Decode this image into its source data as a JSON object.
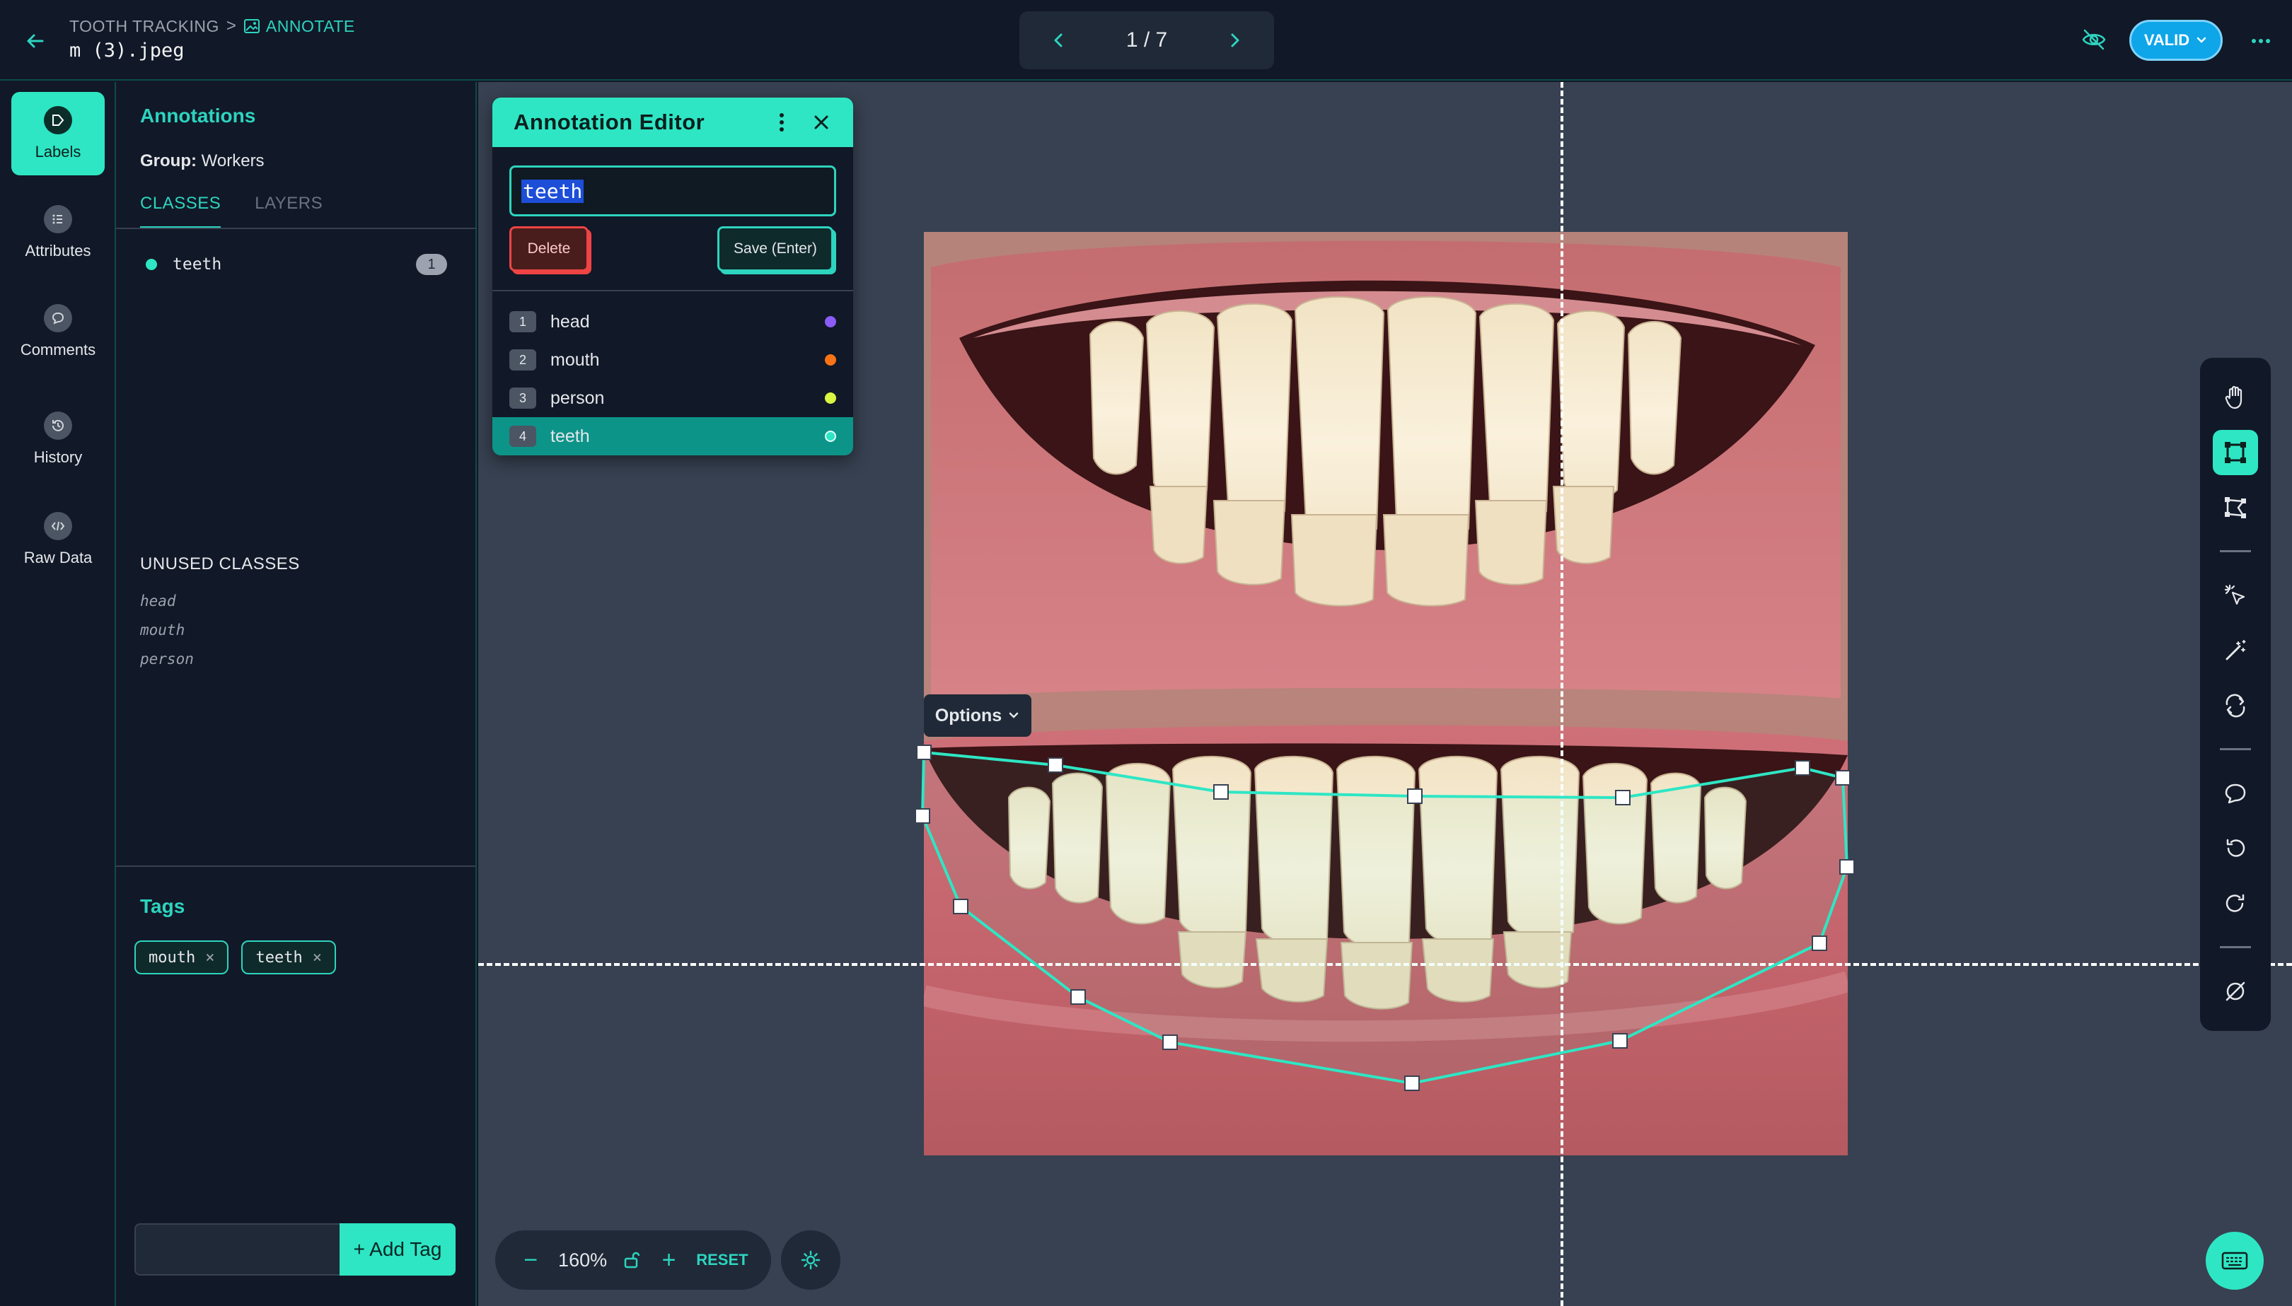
{
  "header": {
    "project": "TOOTH TRACKING",
    "separator": ">",
    "stage": "ANNOTATE",
    "filename": "m (3).jpeg",
    "pager": "1 / 7",
    "status": "VALID"
  },
  "rail": {
    "items": [
      {
        "label": "Labels",
        "icon": "tag-icon"
      },
      {
        "label": "Attributes",
        "icon": "list-icon"
      },
      {
        "label": "Comments",
        "icon": "comment-icon"
      },
      {
        "label": "History",
        "icon": "history-icon"
      },
      {
        "label": "Raw Data",
        "icon": "code-icon"
      }
    ]
  },
  "panel": {
    "title": "Annotations",
    "group_label": "Group:",
    "group_value": "Workers",
    "tabs": [
      "CLASSES",
      "LAYERS"
    ],
    "classes": [
      {
        "name": "teeth",
        "count": "1",
        "color": "#2ee6c4"
      }
    ],
    "unused_title": "UNUSED CLASSES",
    "unused": [
      "head",
      "mouth",
      "person"
    ],
    "tags_title": "Tags",
    "tags": [
      "mouth",
      "teeth"
    ],
    "tag_remove": "×",
    "add_tag": "+ Add Tag"
  },
  "editor": {
    "title": "Annotation Editor",
    "value": "teeth",
    "delete_label": "Delete",
    "save_label": "Save (Enter)",
    "classes": [
      {
        "num": "1",
        "name": "head",
        "color": "#8b5cf6"
      },
      {
        "num": "2",
        "name": "mouth",
        "color": "#f97316"
      },
      {
        "num": "3",
        "name": "person",
        "color": "#d9f542"
      },
      {
        "num": "4",
        "name": "teeth",
        "color": "#2ee6c4"
      }
    ],
    "selected": "teeth"
  },
  "canvas": {
    "options_label": "Options",
    "zoom_minus": "−",
    "zoom_value": "160%",
    "zoom_plus": "+",
    "reset_label": "RESET"
  },
  "colors": {
    "accent": "#2ee6c4",
    "accent_text": "#2dd4bf",
    "background": "#111827",
    "canvas": "#374151",
    "valid": "#0ea5e9",
    "danger": "#ef4444"
  },
  "tools": [
    "hand-icon",
    "bounding-box-icon",
    "polygon-icon",
    "smart-select-icon",
    "magic-wand-icon",
    "convert-icon",
    "comment-icon",
    "undo-icon",
    "redo-icon",
    "clear-icon"
  ]
}
